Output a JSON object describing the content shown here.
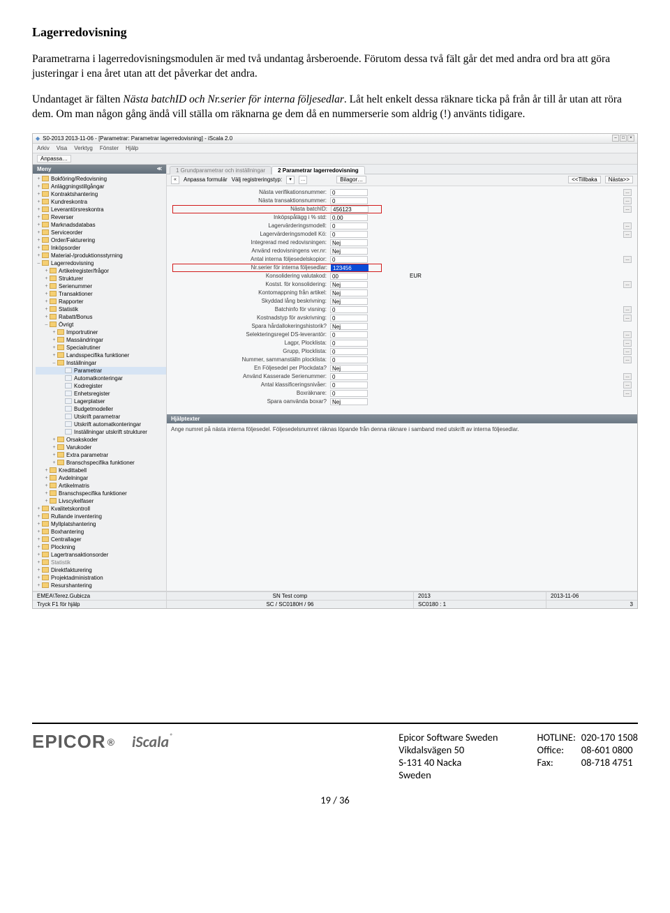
{
  "doc": {
    "heading": "Lagerredovisning",
    "para1": "Parametrarna i lagerredovisningsmodulen är med två undantag årsberoende. Förutom dessa två fält går det med andra ord bra att göra justeringar i ena året utan att det påverkar det andra.",
    "para2a": "Undantaget är fälten ",
    "para2b_italic": "Nästa batchID och Nr.serier för interna följesedlar",
    "para2c": ". Låt helt enkelt dessa räknare ticka på från år till år utan att röra dem. Om man någon gång ändå vill ställa om räknarna ge dem då en nummerserie som aldrig (!) använts tidigare."
  },
  "app": {
    "title": "S0-2013  2013-11-06 - [Parametrar: Parametrar lagerredovisning] - iScala 2.0",
    "menubar": [
      "Arkiv",
      "Visa",
      "Verktyg",
      "Fönster",
      "Hjälp"
    ],
    "toolbar": {
      "btn1": "Anpassa…"
    },
    "sidebar": {
      "title": "Meny",
      "items": [
        {
          "lvl": 1,
          "exp": "+",
          "type": "fold",
          "label": "Bokföring/Redovisning"
        },
        {
          "lvl": 1,
          "exp": "+",
          "type": "fold",
          "label": "Anläggningstillgångar"
        },
        {
          "lvl": 1,
          "exp": "+",
          "type": "fold",
          "label": "Kontraktshantering"
        },
        {
          "lvl": 1,
          "exp": "+",
          "type": "fold",
          "label": "Kundreskontra"
        },
        {
          "lvl": 1,
          "exp": "+",
          "type": "fold",
          "label": "Leverantörsreskontra"
        },
        {
          "lvl": 1,
          "exp": "+",
          "type": "fold",
          "label": "Reverser"
        },
        {
          "lvl": 1,
          "exp": "+",
          "type": "fold",
          "label": "Marknadsdatabas"
        },
        {
          "lvl": 1,
          "exp": "+",
          "type": "fold",
          "label": "Serviceorder"
        },
        {
          "lvl": 1,
          "exp": "+",
          "type": "fold",
          "label": "Order/Fakturering"
        },
        {
          "lvl": 1,
          "exp": "+",
          "type": "fold",
          "label": "Inköpsorder"
        },
        {
          "lvl": 1,
          "exp": "+",
          "type": "fold",
          "label": "Material-/produktionsstyrning"
        },
        {
          "lvl": 1,
          "exp": "–",
          "type": "fold",
          "label": "Lagerredovisning"
        },
        {
          "lvl": 2,
          "exp": "+",
          "type": "fold",
          "label": "Artikelregister/frågor"
        },
        {
          "lvl": 2,
          "exp": "+",
          "type": "fold",
          "label": "Strukturer"
        },
        {
          "lvl": 2,
          "exp": "+",
          "type": "fold",
          "label": "Serienummer"
        },
        {
          "lvl": 2,
          "exp": "+",
          "type": "fold",
          "label": "Transaktioner"
        },
        {
          "lvl": 2,
          "exp": "+",
          "type": "fold",
          "label": "Rapporter"
        },
        {
          "lvl": 2,
          "exp": "+",
          "type": "fold",
          "label": "Statistik"
        },
        {
          "lvl": 2,
          "exp": "+",
          "type": "fold",
          "label": "Rabatt/Bonus"
        },
        {
          "lvl": 2,
          "exp": "–",
          "type": "fold",
          "label": "Övrigt"
        },
        {
          "lvl": 3,
          "exp": "+",
          "type": "fold",
          "label": "Importrutiner"
        },
        {
          "lvl": 3,
          "exp": "+",
          "type": "fold",
          "label": "Massändringar"
        },
        {
          "lvl": 3,
          "exp": "+",
          "type": "fold",
          "label": "Specialrutiner"
        },
        {
          "lvl": 3,
          "exp": "+",
          "type": "fold",
          "label": "Landsspecifika funktioner"
        },
        {
          "lvl": 3,
          "exp": "–",
          "type": "fold",
          "label": "Inställningar"
        },
        {
          "lvl": 4,
          "exp": "",
          "type": "leaf",
          "label": "Parametrar",
          "selected": true
        },
        {
          "lvl": 4,
          "exp": "",
          "type": "leaf",
          "label": "Automatkonteringar"
        },
        {
          "lvl": 4,
          "exp": "",
          "type": "leaf",
          "label": "Kodregister"
        },
        {
          "lvl": 4,
          "exp": "",
          "type": "leaf",
          "label": "Enhetsregister"
        },
        {
          "lvl": 4,
          "exp": "",
          "type": "leaf",
          "label": "Lagerplatser"
        },
        {
          "lvl": 4,
          "exp": "",
          "type": "leaf",
          "label": "Budgetmodeller"
        },
        {
          "lvl": 4,
          "exp": "",
          "type": "leaf",
          "label": "Utskrift parametrar"
        },
        {
          "lvl": 4,
          "exp": "",
          "type": "leaf",
          "label": "Utskrift automatkonteringar"
        },
        {
          "lvl": 4,
          "exp": "",
          "type": "leaf",
          "label": "Inställningar utskrift strukturer"
        },
        {
          "lvl": 3,
          "exp": "+",
          "type": "fold",
          "label": "Orsakskoder"
        },
        {
          "lvl": 3,
          "exp": "+",
          "type": "fold",
          "label": "Varukoder"
        },
        {
          "lvl": 3,
          "exp": "+",
          "type": "fold",
          "label": "Extra parametrar"
        },
        {
          "lvl": 3,
          "exp": "+",
          "type": "fold",
          "label": "Branschspecifika funktioner"
        },
        {
          "lvl": 2,
          "exp": "+",
          "type": "fold",
          "label": "Kredittabell"
        },
        {
          "lvl": 2,
          "exp": "+",
          "type": "fold",
          "label": "Avdelningar"
        },
        {
          "lvl": 2,
          "exp": "+",
          "type": "fold",
          "label": "Artikelmatris"
        },
        {
          "lvl": 2,
          "exp": "+",
          "type": "fold",
          "label": "Branschspecifika funktioner"
        },
        {
          "lvl": 2,
          "exp": "+",
          "type": "fold",
          "label": "Livscykelfaser"
        },
        {
          "lvl": 1,
          "exp": "+",
          "type": "fold",
          "label": "Kvalitetskontroll"
        },
        {
          "lvl": 1,
          "exp": "+",
          "type": "fold",
          "label": "Rullande inventering"
        },
        {
          "lvl": 1,
          "exp": "+",
          "type": "fold",
          "label": "Myllplatshantering"
        },
        {
          "lvl": 1,
          "exp": "+",
          "type": "fold",
          "label": "Boxhantering"
        },
        {
          "lvl": 1,
          "exp": "+",
          "type": "fold",
          "label": "Centrallager"
        },
        {
          "lvl": 1,
          "exp": "+",
          "type": "fold",
          "label": "Plockning"
        },
        {
          "lvl": 1,
          "exp": "+",
          "type": "fold",
          "label": "Lagertransaktionsorder"
        },
        {
          "lvl": 1,
          "exp": "+",
          "type": "fold",
          "label": "Statistik",
          "disabled": true
        },
        {
          "lvl": 1,
          "exp": "+",
          "type": "fold",
          "label": "Direktfakturering"
        },
        {
          "lvl": 1,
          "exp": "+",
          "type": "fold",
          "label": "Projektadministration"
        },
        {
          "lvl": 1,
          "exp": "+",
          "type": "fold",
          "label": "Resurshantering"
        }
      ]
    },
    "tabs": [
      {
        "label": "1 Grundparametrar och inställningar",
        "active": false
      },
      {
        "label": "2 Parametrar lagerredovisning",
        "active": true
      }
    ],
    "subtoolbar": {
      "left_lbl": "Anpassa formulär",
      "left_txt": "Välj registreringstyp:",
      "btn_back": "<<Tillbaka",
      "btn_next": "Nästa>>",
      "btn_bilagor": "Bilagor…"
    },
    "fields": [
      {
        "label": "Nästa verifikationsnummer:",
        "value": "0",
        "browse": true
      },
      {
        "label": "Nästa transaktionsnummer:",
        "value": "0",
        "browse": true
      },
      {
        "label": "Nästa batchID:",
        "value": "456123",
        "browse": true,
        "red": true
      },
      {
        "label": "Inköpspålägg i % std:",
        "value": "0.00",
        "browse": false
      },
      {
        "label": "Lagervärderingsmodell:",
        "value": "0",
        "browse": true
      },
      {
        "label": "Lagervärderingsmodell Kö:",
        "value": "0",
        "browse": true
      },
      {
        "label": "Integrerad med redovisningen:",
        "value": "Nej",
        "browse": false
      },
      {
        "label": "Använd redovisningens ver.nr:",
        "value": "Nej",
        "browse": false
      },
      {
        "label": "Antal interna följesedelskopior:",
        "value": "0",
        "browse": true
      },
      {
        "label": "Nr.serier för interna följesedlar:",
        "value": "123456",
        "browse": false,
        "red": true,
        "blue": true
      },
      {
        "label": "Konsolidering valutakod:",
        "value": "00",
        "browse": false,
        "extra": "EUR"
      },
      {
        "label": "Kostst. för konsolidering:",
        "value": "Nej",
        "browse": true
      },
      {
        "label": "Kontomappning från artikel:",
        "value": "Nej",
        "browse": false
      },
      {
        "label": "Skyddad lång beskrivning:",
        "value": "Nej",
        "browse": false
      },
      {
        "label": "Batchinfo för visning:",
        "value": "0",
        "browse": true
      },
      {
        "label": "Kostnadstyp för avskrivning:",
        "value": "0",
        "browse": true,
        "browseStyle": "wide"
      },
      {
        "label": "Spara hårdallokeringshistorik?",
        "value": "Nej",
        "browse": false
      },
      {
        "label": "Selekteringsregel DS-leverantör:",
        "value": "0",
        "browse": true
      },
      {
        "label": "Lagpr, Plocklista:",
        "value": "0",
        "browse": true
      },
      {
        "label": "Grupp, Plocklista:",
        "value": "0",
        "browse": true
      },
      {
        "label": "Nummer, sammanställn plocklista:",
        "value": "0",
        "browse": true
      },
      {
        "label": "En Följesedel per Plockdata?",
        "value": "Nej",
        "browse": false
      },
      {
        "label": "Använd Kasserade Serienummer:",
        "value": "0",
        "browse": true
      },
      {
        "label": "Antal klassificeringsnivåer:",
        "value": "0",
        "browse": true
      },
      {
        "label": "Boxräknare:",
        "value": "0",
        "browse": true
      },
      {
        "label": "Spara oanvända boxar?",
        "value": "Nej",
        "browse": false
      }
    ],
    "help": {
      "title": "Hjälptexter",
      "body": "Ange numret på nästa interna följesedel. Följesedelsnumret räknas löpande från denna räknare i samband med utskrift av interna följesedlar."
    },
    "status1": {
      "c1": "EMEA\\Terez.Gubicza",
      "c2": "SN Test comp",
      "c3": "2013",
      "c4": "2013-11-06"
    },
    "status2": {
      "c1": "Tryck F1 för hjälp",
      "c2": "SC / SC0180H / 96",
      "c3": "SC0180 : 1",
      "c4": "3"
    }
  },
  "footer": {
    "addr": {
      "l1": "Epicor Software Sweden",
      "l2": "Vikdalsvägen 50",
      "l3": "S-131 40 Nacka",
      "l4": "Sweden"
    },
    "contacts": {
      "hotline_lbl": "HOTLINE:",
      "hotline": "020-170 1508",
      "office_lbl": "Office:",
      "office": "08-601 0800",
      "fax_lbl": "Fax:",
      "fax": "08-718 4751"
    },
    "page": "19 / 36",
    "epicor": "EPICOR",
    "iscala": "iScala"
  }
}
